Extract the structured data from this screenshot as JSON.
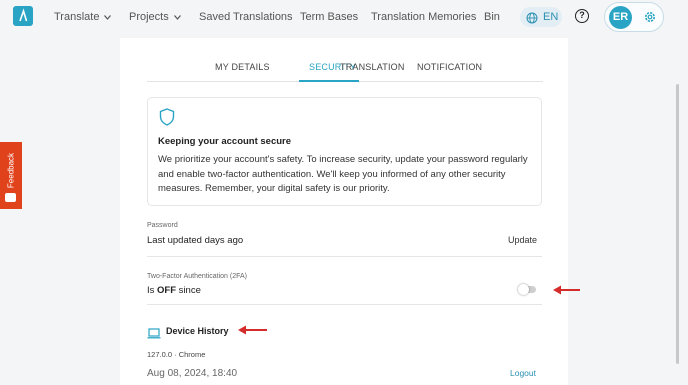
{
  "nav": {
    "items": [
      {
        "label": "Translate",
        "dropdown": true
      },
      {
        "label": "Projects",
        "dropdown": true
      },
      {
        "label": "Saved Translations",
        "dropdown": false
      },
      {
        "label": "Term Bases",
        "dropdown": false
      },
      {
        "label": "Translation Memories",
        "dropdown": false
      },
      {
        "label": "Bin",
        "dropdown": false
      }
    ],
    "language": "EN",
    "help_label": "?",
    "user_initials": "ER"
  },
  "tabs": [
    {
      "label": "MY DETAILS",
      "active": false
    },
    {
      "label": "SECURITY",
      "active": true
    },
    {
      "label": "TRANSLATION",
      "active": false
    },
    {
      "label": "NOTIFICATION",
      "active": false
    }
  ],
  "info_box": {
    "title": "Keeping your account secure",
    "text": "We prioritize your account's safety. To increase security, update your password regularly and enable two-factor authentication. We'll keep you informed of any other security measures. Remember, your digital safety is our priority."
  },
  "password": {
    "label": "Password",
    "value": "Last updated days ago",
    "action": "Update"
  },
  "two_factor": {
    "label": "Two-Factor Authentication (2FA)",
    "prefix": "Is ",
    "state": "OFF",
    "suffix": " since",
    "enabled": false
  },
  "device_history": {
    "title": "Device History",
    "entry_info": "127.0.0 · Chrome",
    "entry_date": "Aug 08, 2024, 18:40",
    "logout_label": "Logout"
  },
  "feedback": {
    "label": "Feedback"
  },
  "colors": {
    "accent": "#2aa4c4",
    "feedback": "#e0421c",
    "arrow": "#d42b2b"
  }
}
